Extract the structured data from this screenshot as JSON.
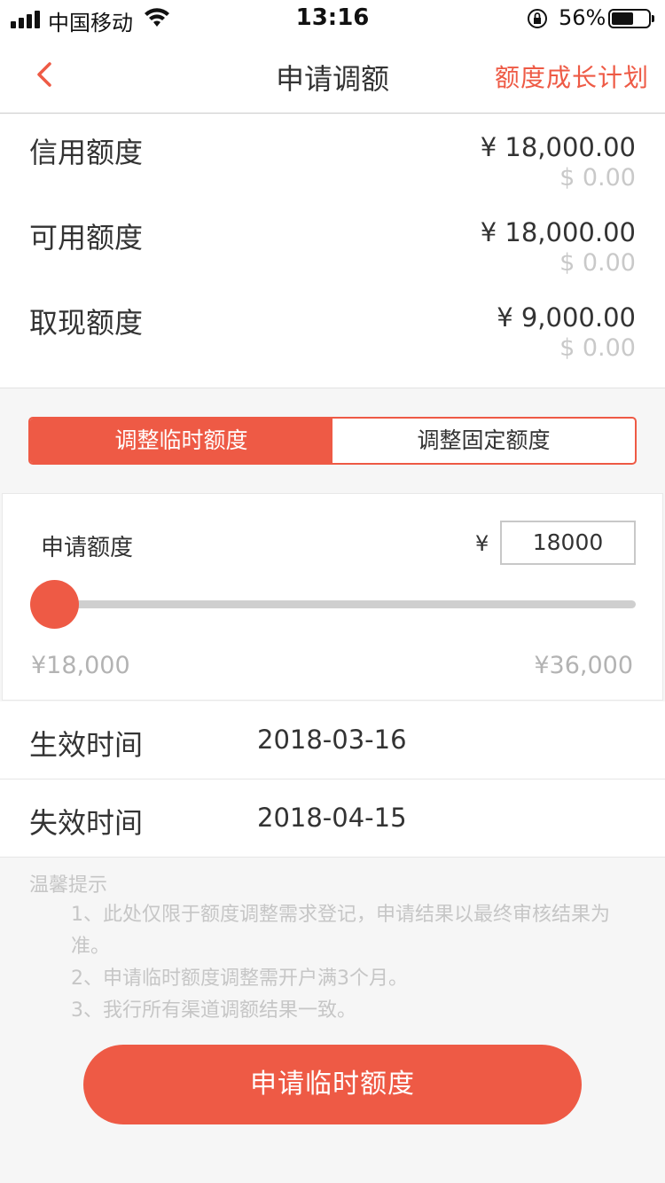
{
  "status_bar": {
    "carrier": "中国移动",
    "time": "13:16",
    "battery_pct": "56%",
    "battery_level": 0.56
  },
  "nav": {
    "title": "申请调额",
    "right_link": "额度成长计划"
  },
  "limits": [
    {
      "label": "信用额度",
      "cny": "¥ 18,000.00",
      "usd": "$ 0.00"
    },
    {
      "label": "可用额度",
      "cny": "¥ 18,000.00",
      "usd": "$ 0.00"
    },
    {
      "label": "取现额度",
      "cny": "¥ 9,000.00",
      "usd": "$ 0.00"
    }
  ],
  "segment": {
    "options": [
      "调整临时额度",
      "调整固定额度"
    ],
    "selected": "调整临时额度"
  },
  "apply": {
    "label": "申请额度",
    "currency": "¥",
    "amount": "18000",
    "slider_min_label": "¥18,000",
    "slider_max_label": "¥36,000",
    "slider_value": 18000
  },
  "dates": {
    "effective_label": "生效时间",
    "effective_value": "2018-03-16",
    "expire_label": "失效时间",
    "expire_value": "2018-04-15"
  },
  "tips": {
    "title": "温馨提示",
    "items": [
      "1、此处仅限于额度调整需求登记，申请结果以最终审核结果为准。",
      "2、申请临时额度调整需开户满3个月。",
      "3、我行所有渠道调额结果一致。"
    ]
  },
  "submit_label": "申请临时额度",
  "colors": {
    "accent": "#ee5a45",
    "muted_text": "#c6c6c6"
  }
}
